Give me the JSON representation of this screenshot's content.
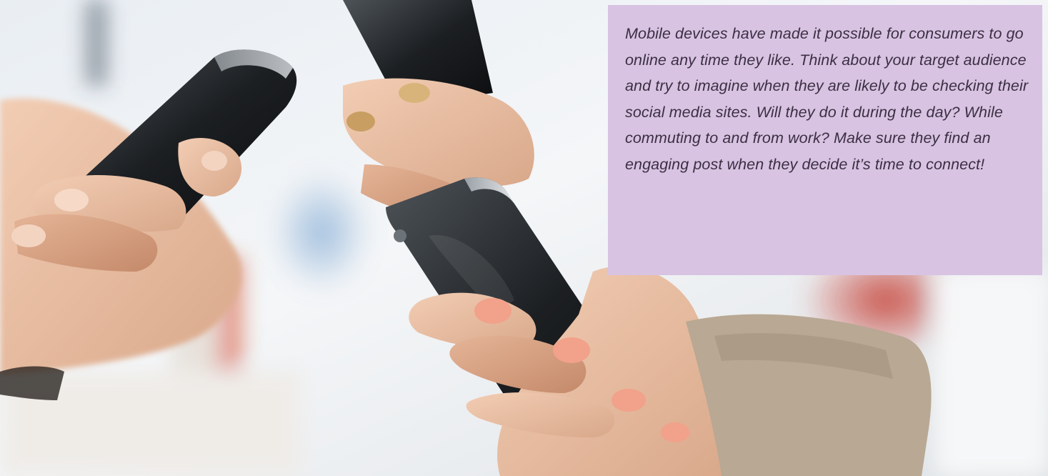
{
  "callout": {
    "text": "Mobile devices have made it possible for consumers to go online any time they like. Think about your target audience and try to imagine when they are likely to be checking their social media sites. Will they do it during the day? While commuting to and from work? Make sure they find an engaging post when they decide it’s time to connect!",
    "background_color": "#d8c3e2",
    "text_color": "#3b2f43"
  },
  "photo": {
    "subject": "hands-holding-smartphones"
  }
}
